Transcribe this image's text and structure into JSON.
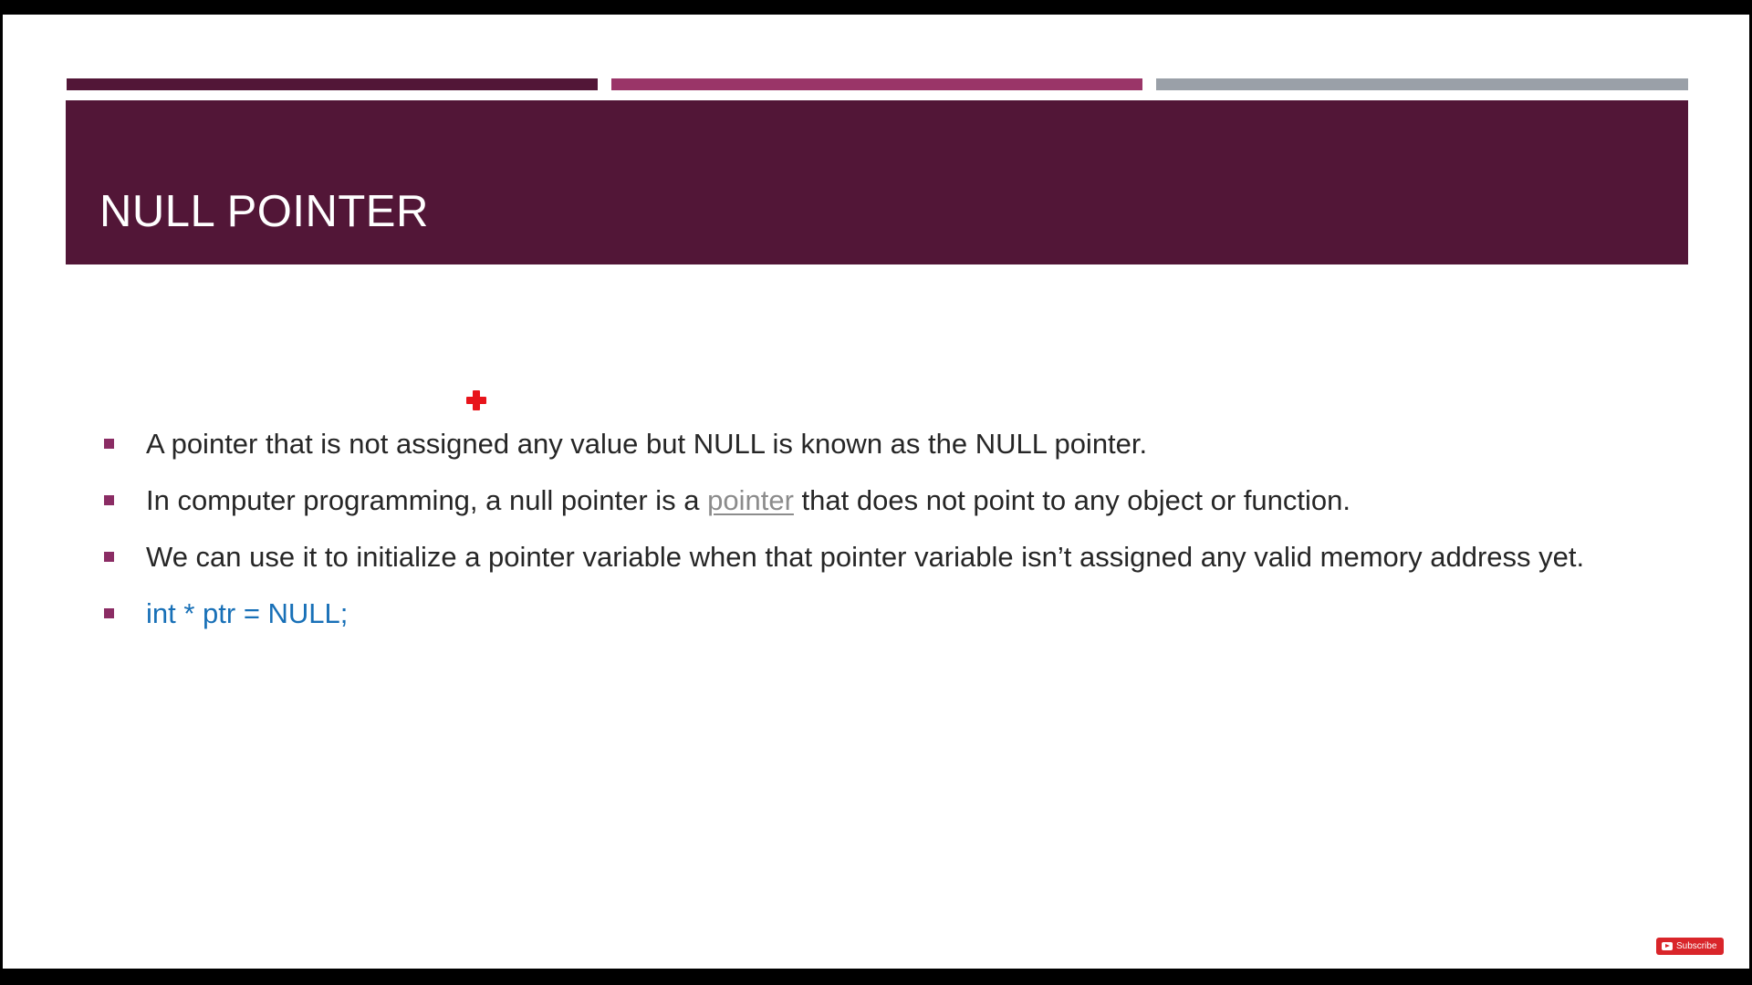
{
  "slide": {
    "title": "NULL POINTER",
    "bullets": [
      {
        "text": "A pointer that is not assigned any value but NULL is known as the NULL pointer.",
        "color": "#262626"
      },
      {
        "before": "In computer programming, a null pointer is a ",
        "link": "pointer",
        "after": " that does not point to any object or function.",
        "color": "#262626",
        "link_color": "#8c8c8c"
      },
      {
        "text": "We can use it to initialize a pointer variable when that pointer variable isn’t assigned any valid memory address yet.",
        "color": "#262626"
      },
      {
        "text": "int * ptr = NULL;",
        "color": "#1870b7"
      }
    ]
  },
  "theme": {
    "accent_colors": [
      "#521637",
      "#9a3568",
      "#9aa0a8"
    ],
    "title_band_color": "#521637",
    "bullet_color": "#8b2c64",
    "frame_color": "#000000",
    "background_color": "#ffffff"
  },
  "overlay": {
    "cursor_icon": "red-cross-cursor",
    "subscribe_label": "Subscribe",
    "subscribe_icon": "youtube-play-icon",
    "subscribe_color": "#d9252a"
  }
}
